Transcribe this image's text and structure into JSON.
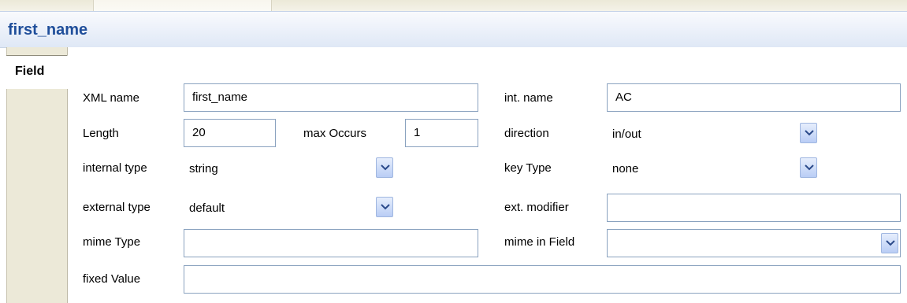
{
  "header": {
    "title": "first_name"
  },
  "tabs": [
    {
      "label": "Field"
    }
  ],
  "form": {
    "xml_name": {
      "label": "XML name",
      "value": "first_name"
    },
    "int_name": {
      "label": "int. name",
      "value": "AC"
    },
    "length": {
      "label": "Length",
      "value": "20"
    },
    "max_occurs": {
      "label": "max Occurs",
      "value": "1"
    },
    "direction": {
      "label": "direction",
      "value": "in/out"
    },
    "internal_type": {
      "label": "internal type",
      "value": "string"
    },
    "key_type": {
      "label": "key Type",
      "value": "none"
    },
    "external_type": {
      "label": "external type",
      "value": "default"
    },
    "ext_modifier": {
      "label": "ext. modifier",
      "value": ""
    },
    "mime_type": {
      "label": "mime Type",
      "value": ""
    },
    "mime_in_field": {
      "label": "mime in Field",
      "value": ""
    },
    "fixed_value": {
      "label": "fixed Value",
      "value": ""
    }
  },
  "icons": {
    "dropdown": "chevron-down-icon"
  },
  "colors": {
    "title": "#1f4e9a",
    "field_border": "#8aa2bf",
    "sidebar": "#ece9d8"
  }
}
